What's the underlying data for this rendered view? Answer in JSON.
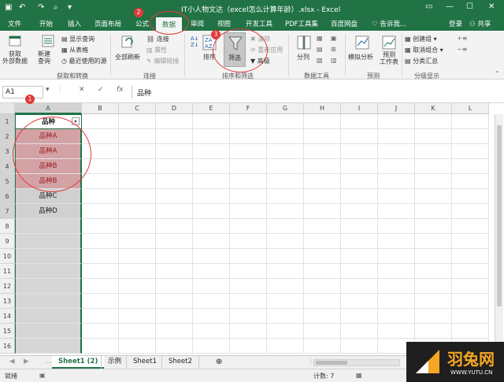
{
  "title": "IT小人物文达（excel怎么计算年龄）.xlsx - Excel",
  "tabs": [
    "文件",
    "开始",
    "插入",
    "页面布局",
    "公式",
    "数据",
    "审阅",
    "视图",
    "开发工具",
    "PDF工具集",
    "百度网盘"
  ],
  "tell_me": "告诉我...",
  "login": "登录",
  "share": "共享",
  "ribbon": {
    "get_external": "获取\n外部数据",
    "new_query": "新建\n查询",
    "show_queries": "显示查询",
    "from_table": "从表格",
    "recent_sources": "最近使用的源",
    "group_get": "获取和转换",
    "refresh_all": "全部刷新",
    "connections": "连接",
    "properties": "属性",
    "edit_links": "编辑链接",
    "group_conn": "连接",
    "sort": "排序",
    "filter": "筛选",
    "clear": "清除",
    "reapply": "重新应用",
    "advanced": "高级",
    "group_sort": "排序和筛选",
    "text_to_cols": "分列",
    "group_tools": "数据工具",
    "what_if": "模拟分析",
    "forecast": "预测\n工作表",
    "group_forecast": "预测",
    "group_btn": "创建组",
    "ungroup": "取消组合",
    "subtotal": "分类汇总",
    "group_outline": "分级显示"
  },
  "namebox": "A1",
  "formula": "品种",
  "columns": [
    "A",
    "B",
    "C",
    "D",
    "E",
    "F",
    "G",
    "H",
    "I",
    "J",
    "K",
    "L"
  ],
  "rows": [
    "1",
    "2",
    "3",
    "4",
    "5",
    "6",
    "7",
    "8",
    "9",
    "10",
    "11",
    "12",
    "13",
    "14",
    "15",
    "16"
  ],
  "cells": [
    "品种",
    "品种A",
    "品种A",
    "品种B",
    "品种B",
    "品种C",
    "品种D"
  ],
  "sheets": [
    "Sheet1 (2)",
    "示例",
    "Sheet1",
    "Sheet2"
  ],
  "status_ready": "就绪",
  "status_count": "计数: 7",
  "badges": [
    "1",
    "2",
    "3"
  ],
  "watermark": "羽兔网",
  "watermark_url": "WWW.YUTU.CN"
}
